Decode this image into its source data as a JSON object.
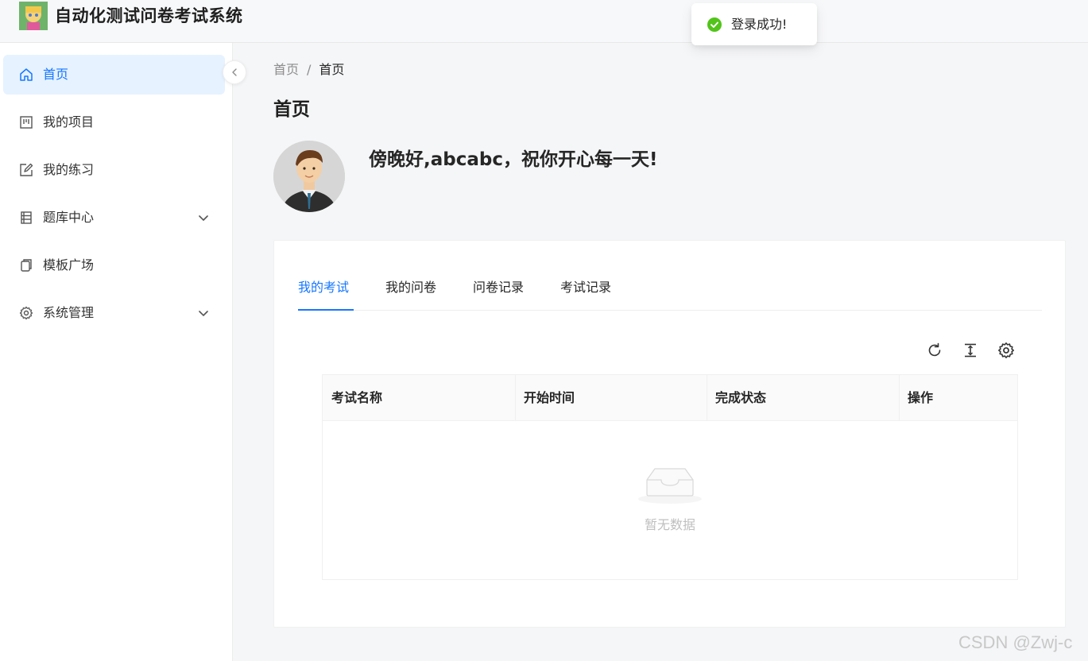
{
  "header": {
    "app_title": "自动化测试问卷考试系统"
  },
  "toast": {
    "message": "登录成功!",
    "icon": "check-circle-icon",
    "color": "#52c41a"
  },
  "sidebar": {
    "items": [
      {
        "label": "首页",
        "icon": "home-icon",
        "active": true
      },
      {
        "label": "我的项目",
        "icon": "project-board-icon"
      },
      {
        "label": "我的练习",
        "icon": "edit-icon"
      },
      {
        "label": "题库中心",
        "icon": "question-bank-icon",
        "expandable": true
      },
      {
        "label": "模板广场",
        "icon": "template-copy-icon"
      },
      {
        "label": "系统管理",
        "icon": "gear-icon",
        "expandable": true
      }
    ]
  },
  "breadcrumb": {
    "root": "首页",
    "separator": "/",
    "current": "首页"
  },
  "page": {
    "title": "首页",
    "greeting": "傍晚好,abcabc，祝你开心每一天!"
  },
  "tabs": [
    {
      "label": "我的考试",
      "active": true
    },
    {
      "label": "我的问卷"
    },
    {
      "label": "问卷记录"
    },
    {
      "label": "考试记录"
    }
  ],
  "table": {
    "columns": [
      "考试名称",
      "开始时间",
      "完成状态",
      "操作"
    ],
    "rows": [],
    "empty_text": "暂无数据",
    "toolbar_icons": [
      "reload-icon",
      "row-height-icon",
      "settings-icon"
    ]
  },
  "watermark": "CSDN @Zwj-c",
  "colors": {
    "accent": "#1677ff",
    "active_bg": "#e6f2ff"
  }
}
